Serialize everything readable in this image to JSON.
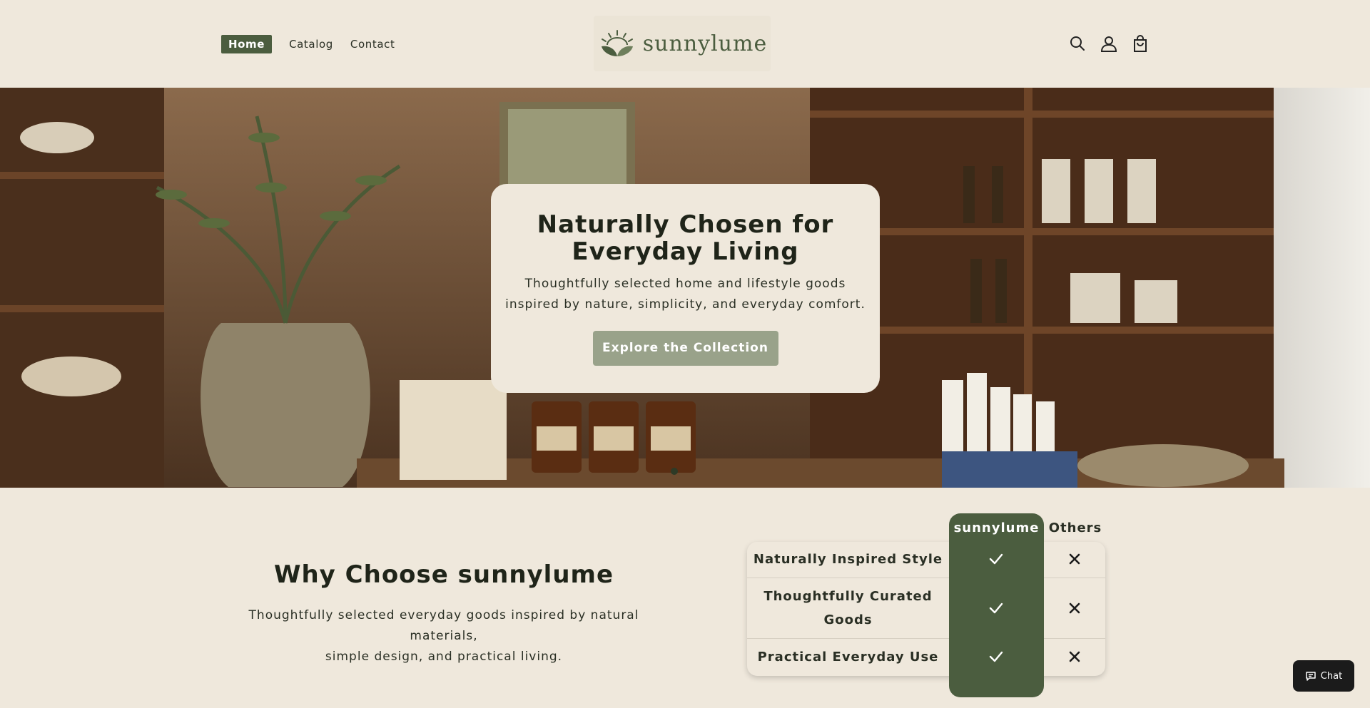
{
  "brand": {
    "name": "sunnylume"
  },
  "nav": {
    "items": [
      {
        "label": "Home",
        "active": true
      },
      {
        "label": "Catalog",
        "active": false
      },
      {
        "label": "Contact",
        "active": false
      }
    ]
  },
  "header_icons": [
    "search-icon",
    "account-icon",
    "cart-icon"
  ],
  "hero": {
    "title_line1": "Naturally Chosen for",
    "title_line2": "Everyday Living",
    "subtitle_line1": "Thoughtfully selected home and lifestyle goods",
    "subtitle_line2": "inspired by nature, simplicity, and everyday comfort.",
    "cta_label": "Explore the Collection"
  },
  "why": {
    "title": "Why Choose sunnylume",
    "text_line1": "Thoughtfully selected everyday goods inspired by natural materials,",
    "text_line2": "simple design, and practical living."
  },
  "comparison": {
    "col_brand": "sunnylume",
    "col_others": "Others",
    "rows": [
      {
        "label": "Naturally Inspired Style",
        "brand": true,
        "others": false
      },
      {
        "label_line1": "Thoughtfully Curated",
        "label_line2": "Goods",
        "brand": true,
        "others": false
      },
      {
        "label": "Practical Everyday Use",
        "brand": true,
        "others": false
      }
    ]
  },
  "chat": {
    "label": "Chat"
  },
  "colors": {
    "background": "#efe8dc",
    "accent_green": "#4b5d3f",
    "button_sage": "#99a28a",
    "text_dark": "#1f2419"
  }
}
